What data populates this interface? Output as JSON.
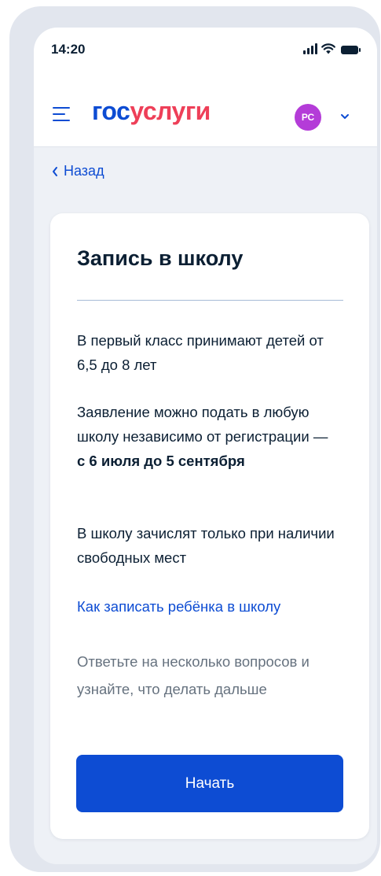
{
  "status_bar": {
    "time": "14:20",
    "icons": [
      "signal-icon",
      "wifi-icon",
      "battery-icon"
    ]
  },
  "header": {
    "logo_part1": "гос",
    "logo_part2": "услуги",
    "avatar_initials": "РС",
    "colors": {
      "brand_blue": "#0d4cd3",
      "brand_red": "#ee3f58",
      "avatar": "#b43cd8"
    }
  },
  "nav": {
    "back_label": "Назад"
  },
  "card": {
    "title": "Запись в школу",
    "para1": "В первый класс принимают детей от 6,5 до 8 лет",
    "para2_text": "Заявление можно подать в любую школу независимо от регистрации — ",
    "para2_bold": "с 6 июля до 5 сентября",
    "para3": "В школу зачислят только при наличии свободных мест",
    "link_label": "Как записать ребёнка в школу",
    "hint": "Ответьте на несколько вопросов и узнайте, что делать дальше",
    "start_label": "Начать"
  }
}
